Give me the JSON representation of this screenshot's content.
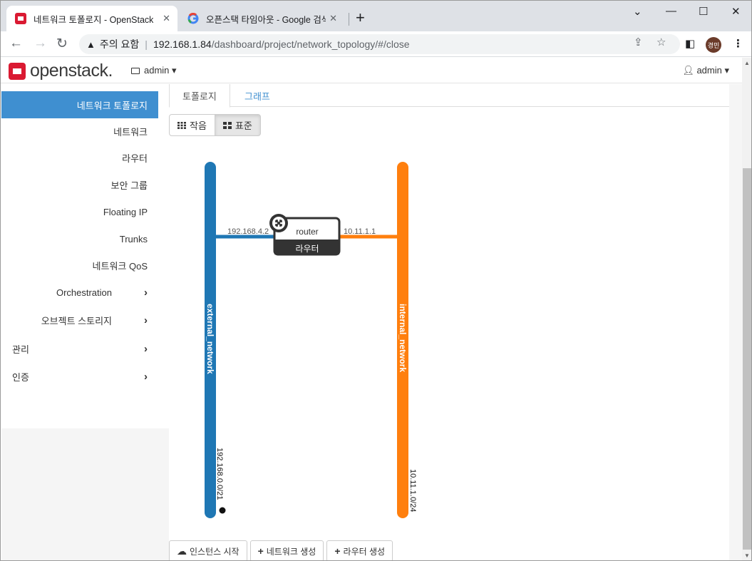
{
  "browser": {
    "tabs": [
      {
        "title": "네트워크 토폴로지 - OpenStack",
        "close": "✕"
      },
      {
        "title": "오픈스택 타임아웃 - Google 검색",
        "close": "✕"
      }
    ],
    "new_tab": "+",
    "window_controls": {
      "minimize": "⌄",
      "min": "—",
      "max": "☐",
      "close": "✕"
    },
    "address": {
      "security_label": "주의 요함",
      "host": "192.168.1.84",
      "path": "/dashboard/project/network_topology/#/close"
    },
    "profile_initials": "경민"
  },
  "header": {
    "logo_text": "openstack.",
    "project": "admin ▾",
    "user": "admin ▾"
  },
  "sidebar": {
    "items": [
      {
        "label": "네트워크 토폴로지"
      },
      {
        "label": "네트워크"
      },
      {
        "label": "라우터"
      },
      {
        "label": "보안 그룹"
      },
      {
        "label": "Floating IP"
      },
      {
        "label": "Trunks"
      },
      {
        "label": "네트워크 QoS"
      },
      {
        "label": "Orchestration"
      },
      {
        "label": "오브젝트 스토리지"
      },
      {
        "label": "관리"
      },
      {
        "label": "인증"
      }
    ]
  },
  "main": {
    "tabs": [
      {
        "label": "토폴로지"
      },
      {
        "label": "그래프"
      }
    ],
    "view_buttons": [
      {
        "label": "작음"
      },
      {
        "label": "표준"
      }
    ],
    "actions": [
      {
        "label": "인스턴스 시작"
      },
      {
        "label": "네트워크 생성"
      },
      {
        "label": "라우터 생성"
      }
    ]
  },
  "topology": {
    "networks": [
      {
        "name": "external_network",
        "cidr": "192.168.0.0/21",
        "color": "#1f77b4"
      },
      {
        "name": "internal_network",
        "cidr": "10.11.1.0/24",
        "color": "#ff7f0e"
      }
    ],
    "router": {
      "name": "router",
      "type_label": "라우터"
    },
    "ports": [
      {
        "ip": "192.168.4.2"
      },
      {
        "ip": "10.11.1.1"
      }
    ]
  }
}
